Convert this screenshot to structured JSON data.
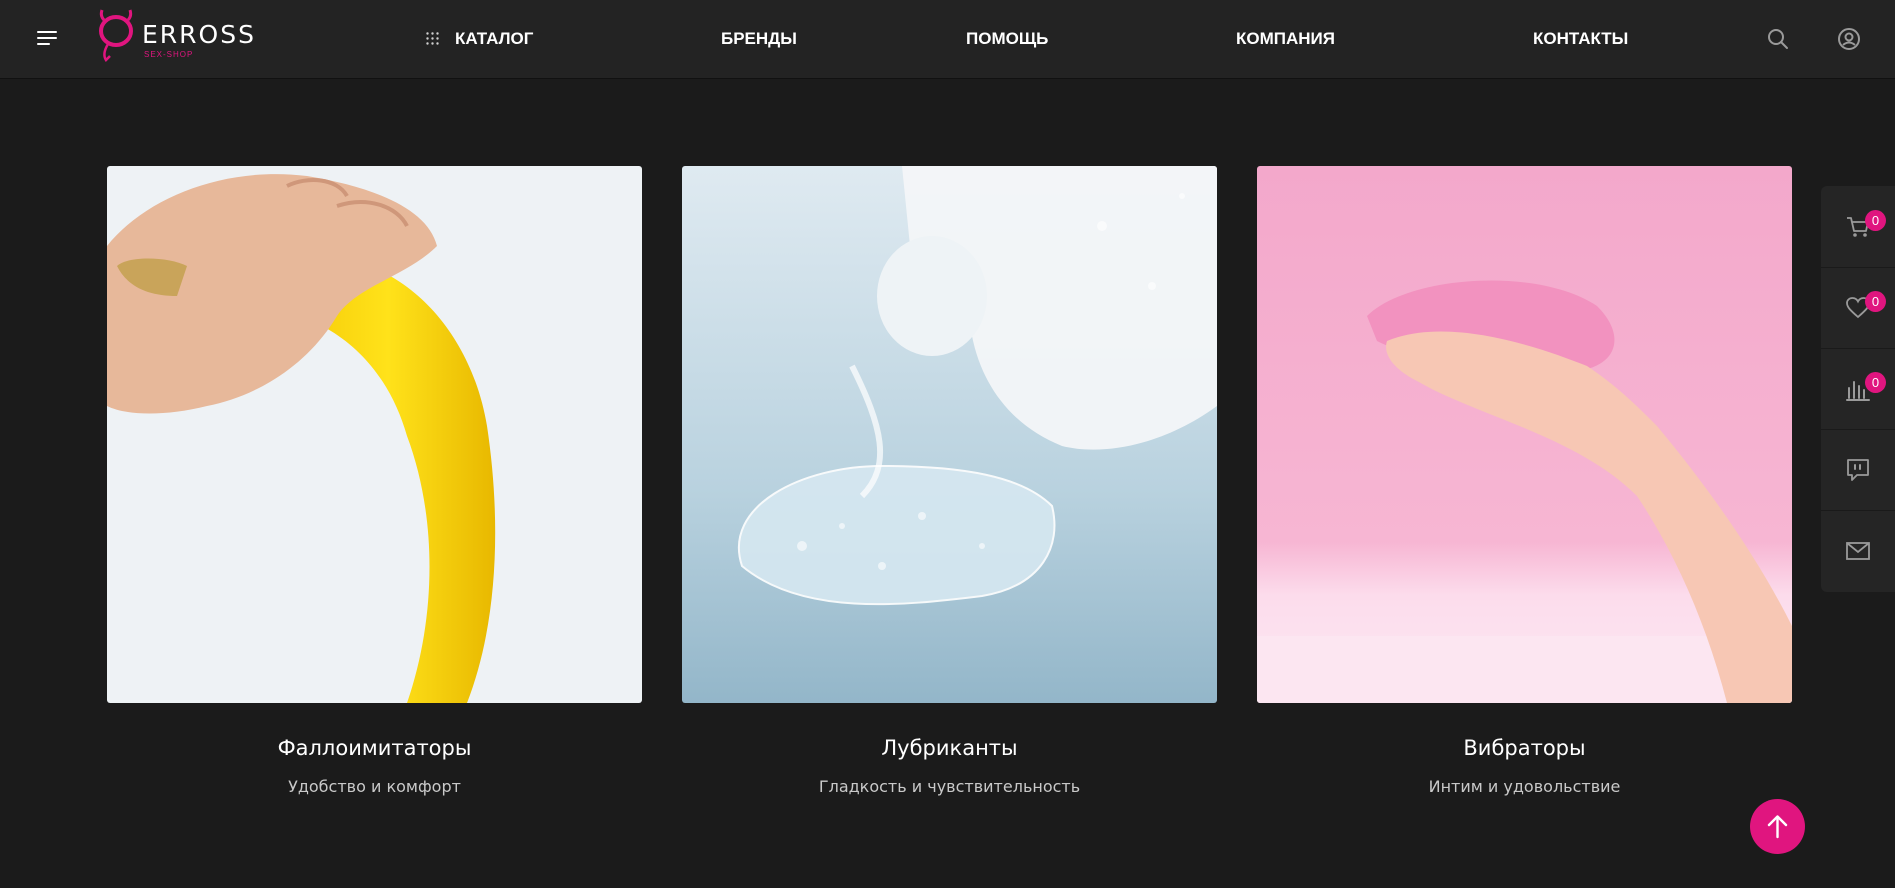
{
  "header": {
    "logo_text": "ERROSS",
    "logo_sub": "SEX-SHOP",
    "nav": [
      {
        "label": "КАТАЛОГ"
      },
      {
        "label": "БРЕНДЫ"
      },
      {
        "label": "ПОМОЩЬ"
      },
      {
        "label": "КОМПАНИЯ"
      },
      {
        "label": "КОНТАКТЫ"
      }
    ],
    "icons": [
      "menu-icon",
      "grid-icon",
      "search-icon",
      "user-icon"
    ]
  },
  "categories": [
    {
      "title": "Фаллоимитаторы",
      "subtitle": "Удобство и комфорт",
      "image": "banana-in-hand"
    },
    {
      "title": "Лубриканты",
      "subtitle": "Гладкость и чувствительность",
      "image": "gel-from-bottle"
    },
    {
      "title": "Вибраторы",
      "subtitle": "Интим и удовольствие",
      "image": "pink-vibrator-in-hand"
    }
  ],
  "sidebar": {
    "cart_count": "0",
    "favorites_count": "0",
    "compare_count": "0",
    "icons": [
      "cart-icon",
      "heart-icon",
      "compare-icon",
      "chat-icon",
      "mail-icon"
    ]
  },
  "colors": {
    "accent": "#e0157f",
    "background": "#1b1b1b",
    "header": "#232323"
  }
}
